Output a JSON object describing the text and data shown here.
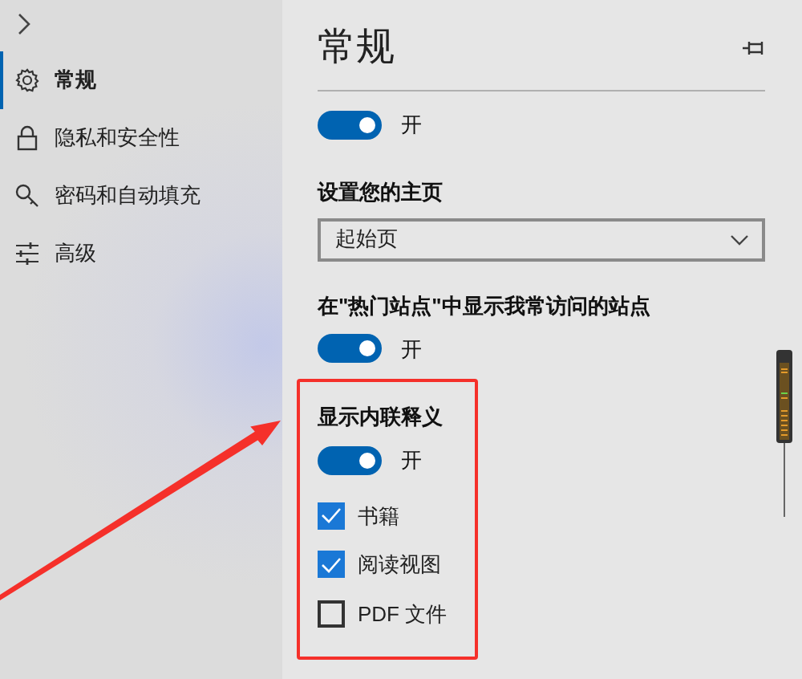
{
  "sidebar": {
    "items": [
      {
        "label": "常规",
        "selected": true
      },
      {
        "label": "隐私和安全性",
        "selected": false
      },
      {
        "label": "密码和自动填充",
        "selected": false
      },
      {
        "label": "高级",
        "selected": false
      }
    ]
  },
  "panel": {
    "title": "常规",
    "settings": [
      {
        "kind": "toggle",
        "on": true,
        "label": "开"
      },
      {
        "kind": "heading",
        "label": "设置您的主页"
      },
      {
        "kind": "dropdown",
        "value": "起始页"
      },
      {
        "kind": "heading",
        "label": "在\"热门站点\"中显示我常访问的站点"
      },
      {
        "kind": "toggle",
        "on": true,
        "label": "开"
      }
    ],
    "highlighted_group": {
      "settings": [
        {
          "kind": "heading",
          "label": "显示内联释义"
        },
        {
          "kind": "toggle",
          "on": true,
          "label": "开"
        },
        {
          "kind": "checkbox",
          "checked": true,
          "label": "书籍"
        },
        {
          "kind": "checkbox",
          "checked": true,
          "label": "阅读视图"
        },
        {
          "kind": "checkbox",
          "checked": false,
          "label": "PDF 文件"
        }
      ]
    }
  }
}
